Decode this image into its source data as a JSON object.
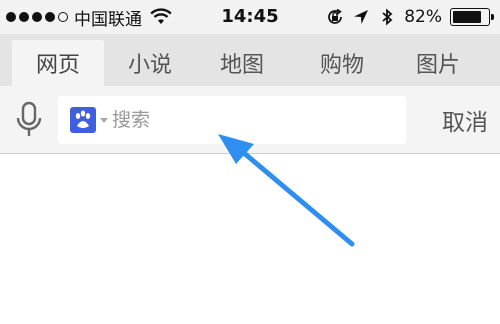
{
  "status_bar": {
    "carrier": "中国联通",
    "time": "14:45",
    "battery_percent": "82%",
    "battery_level": 0.82,
    "signal_bars_filled": 4,
    "signal_bars_total": 5,
    "icons": [
      "wifi-icon",
      "rotation-lock-icon",
      "location-arrow-icon",
      "bluetooth-icon",
      "battery-icon"
    ]
  },
  "tabs": [
    {
      "label": "网页",
      "active": true
    },
    {
      "label": "小说",
      "active": false
    },
    {
      "label": "地图",
      "active": false
    },
    {
      "label": "购物",
      "active": false
    },
    {
      "label": "图片",
      "active": false
    }
  ],
  "search": {
    "placeholder": "搜索",
    "engine_icon": "baidu-paw-icon",
    "voice_icon": "microphone-icon",
    "cancel_label": "取消"
  },
  "colors": {
    "annotation_arrow": "#2f8ff0",
    "engine_logo": "#3f5fdc"
  }
}
